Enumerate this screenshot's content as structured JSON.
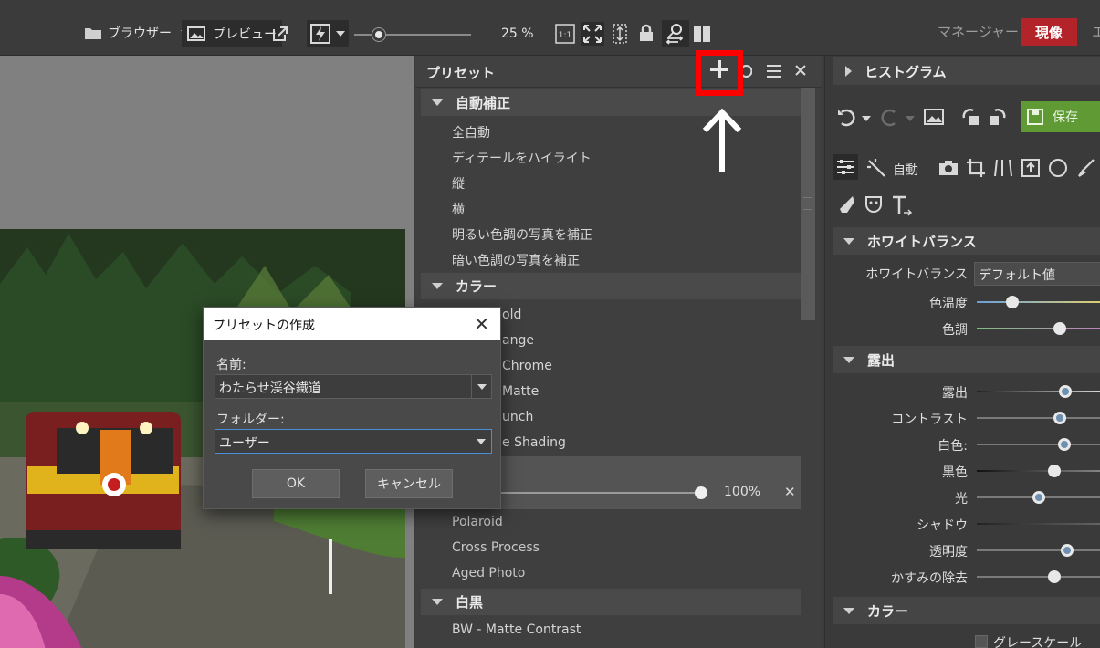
{
  "toolbar": {
    "browser_label": "ブラウザー",
    "preview_label": "プレビュー",
    "zoom": "25 %",
    "manager_label": "マネージャー",
    "develop_label": "現像",
    "edge_text": "エ"
  },
  "preset_panel": {
    "title": "プリセット",
    "sections": [
      {
        "name": "自動補正",
        "items": [
          "全自動",
          "ディテールをハイライト",
          "縦",
          "横",
          "明るい色調の写真を補正",
          "暗い色調の写真を補正"
        ]
      },
      {
        "name": "カラー",
        "items": [
          "old",
          "ange",
          "Chrome",
          "Matte",
          "unch",
          "e Shading"
        ]
      },
      {
        "name": "白黒",
        "items": [
          "BW - Matte Contrast"
        ]
      }
    ],
    "more_items": [
      "Polaroid",
      "Cross Process",
      "Aged Photo"
    ],
    "selected_strength": "100%"
  },
  "right_panel": {
    "histogram": "ヒストグラム",
    "save": "保存",
    "auto": "自動",
    "white_balance": {
      "section": "ホワイトバランス",
      "label": "ホワイトバランス",
      "value": "デフォルト値",
      "sliders": [
        {
          "label": "色温度",
          "value": 0.29
        },
        {
          "label": "色調",
          "value": 0.66
        }
      ]
    },
    "exposure": {
      "section": "露出",
      "sliders": [
        {
          "label": "露出",
          "value": 0.7
        },
        {
          "label": "コントラスト",
          "value": 0.66
        },
        {
          "label": "白色:",
          "value": 0.69
        },
        {
          "label": "黒色",
          "value": 0.61
        },
        {
          "label": "光",
          "value": 0.49
        },
        {
          "label": "シャドウ",
          "value": null
        },
        {
          "label": "透明度",
          "value": 0.71
        },
        {
          "label": "かすみの除去",
          "value": 0.61
        }
      ]
    },
    "color": {
      "section": "カラー",
      "grayscale": "グレースケール"
    }
  },
  "dialog": {
    "title": "プリセットの作成",
    "name_label": "名前:",
    "name_value": "わたらせ渓谷鐵道",
    "folder_label": "フォルダー:",
    "folder_value": "ユーザー",
    "ok": "OK",
    "cancel": "キャンセル"
  },
  "colors": {
    "accent_red": "#b3242a",
    "save_green": "#5f9a34",
    "highlight": "#ff0000"
  }
}
